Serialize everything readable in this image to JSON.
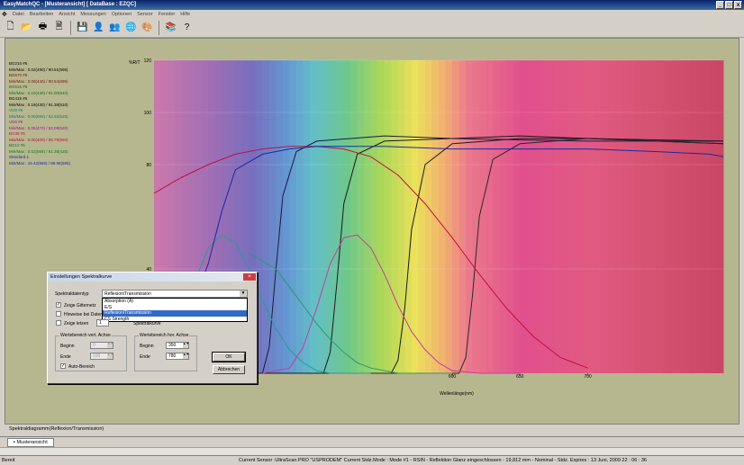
{
  "window": {
    "title": "EasyMatchQC - [Musteransicht]  [ DataBase : EZQC]"
  },
  "menu": [
    "Datei",
    "Bearbeiten",
    "Ansicht",
    "Messungen",
    "Optionen",
    "Sensor",
    "Fenster",
    "Hilfe"
  ],
  "toolbar": {
    "icons": [
      "new-file-icon",
      "open-folder-icon",
      "print-icon",
      "print-preview-icon",
      "save-icon",
      "user-icon",
      "users-icon",
      "standard-icon",
      "sample-icon",
      "database-icon",
      "help-icon"
    ],
    "glyphs": [
      "🗋",
      "📂",
      "🖶",
      "🗎",
      "💾",
      "👤",
      "👥",
      "🌐",
      "🎨",
      "📚",
      "?"
    ]
  },
  "legend": [
    {
      "name": "BG210 #5",
      "value": "Min/Max : 0.02(490) / 90.51(595)",
      "color": "#000000"
    },
    {
      "name": "BG670 #5",
      "value": "Min/Max : 0.08(440) / 90.54(695)",
      "color": "#7a1010"
    },
    {
      "name": "BG515 #5",
      "value": "Min/Max : 0.10(430) / 91.00(640)",
      "color": "#1a6a1a"
    },
    {
      "name": "BG415 #5",
      "value": "Min/Max : 0.18(430) / 91.38(510)",
      "color": "#000000"
    },
    {
      "name": "VG9 #5",
      "value": "Min/Max : 0.00(555) / 52.92(525)",
      "color": "#0a7a6a"
    },
    {
      "name": "VG6 #5",
      "value": "Min/Max : 0.05(470) / 53.09(520)",
      "color": "#a01090"
    },
    {
      "name": "BG38 #5",
      "value": "Min/Max : 0.00(400) / 88.79(550)",
      "color": "#c01040"
    },
    {
      "name": "BG12 #5",
      "value": "Min/Max : 0.02(555) / 81.35(425)",
      "color": "#0a7a20"
    },
    {
      "name": "Standard 1",
      "value": "Min/Max : 15.42(585) / 88.86(585)",
      "color": "#1a2aa0"
    }
  ],
  "chart_data": {
    "type": "line",
    "ylabel": "%R/T",
    "xlabel": "Wellenlänge(nm)",
    "xlim": [
      380,
      800
    ],
    "ylim": [
      0,
      120
    ],
    "yticks": [
      40,
      80,
      100,
      120
    ],
    "xticks": [
      600,
      650,
      700
    ],
    "xtick_labels": [
      "600",
      "650",
      "700"
    ],
    "ytick_labels": [
      "40",
      "80",
      "100",
      "120"
    ],
    "grid": true,
    "series": [
      {
        "name": "BG210 #5",
        "color": "#1a1a1a",
        "x": [
          380,
          555,
          560,
          565,
          570,
          580,
          600,
          650,
          700,
          750,
          800
        ],
        "y": [
          0,
          0,
          5,
          25,
          55,
          80,
          88,
          90,
          90,
          89,
          88
        ]
      },
      {
        "name": "BG670 #5",
        "color": "#2a2a2a",
        "x": [
          380,
          605,
          610,
          615,
          620,
          630,
          650,
          700,
          750,
          800
        ],
        "y": [
          0,
          0,
          6,
          30,
          60,
          82,
          88,
          90,
          89,
          88
        ]
      },
      {
        "name": "BG515 #5",
        "color": "#1a1a1a",
        "x": [
          380,
          505,
          510,
          515,
          520,
          530,
          550,
          600,
          650,
          700,
          800
        ],
        "y": [
          0,
          0,
          8,
          35,
          65,
          84,
          89,
          90,
          91,
          90,
          89
        ]
      },
      {
        "name": "BG415 #5",
        "color": "#1a1a40",
        "x": [
          380,
          460,
          465,
          470,
          475,
          485,
          500,
          550,
          600,
          700,
          800
        ],
        "y": [
          0,
          0,
          10,
          40,
          68,
          85,
          89,
          91,
          90,
          89,
          89
        ]
      },
      {
        "name": "VG9 #5",
        "color": "#2a9a9a",
        "x": [
          380,
          400,
          410,
          420,
          430,
          440,
          450,
          460,
          470,
          480,
          490,
          500,
          510,
          520,
          530,
          540
        ],
        "y": [
          6,
          20,
          35,
          48,
          53,
          50,
          40,
          28,
          17,
          9,
          4,
          1,
          0,
          0,
          0,
          0
        ]
      },
      {
        "name": "VG6 #5",
        "color": "#c040a0",
        "x": [
          460,
          480,
          490,
          500,
          510,
          520,
          530,
          540,
          550,
          560,
          570,
          580,
          590,
          600,
          620,
          650
        ],
        "y": [
          0,
          2,
          10,
          25,
          42,
          52,
          53,
          48,
          38,
          26,
          16,
          9,
          4,
          1,
          0,
          0
        ]
      },
      {
        "name": "BG38 #5",
        "color": "#c01040",
        "x": [
          380,
          400,
          420,
          440,
          460,
          480,
          500,
          520,
          540,
          560,
          580,
          600,
          620,
          640,
          660,
          680,
          700
        ],
        "y": [
          69,
          75,
          80,
          84,
          86,
          87,
          87,
          86,
          83,
          76,
          65,
          52,
          38,
          25,
          14,
          6,
          2
        ]
      },
      {
        "name": "BG12 #5",
        "color": "#2a9a6a",
        "x": [
          450,
          470,
          480,
          490,
          500,
          510,
          520,
          530,
          540,
          550,
          560,
          570,
          580,
          600
        ],
        "y": [
          46,
          40,
          33,
          26,
          19,
          13,
          8,
          4,
          2,
          1,
          0,
          0,
          0,
          0
        ]
      },
      {
        "name": "Standard 1",
        "color": "#1a2aa0",
        "x": [
          380,
          400,
          410,
          420,
          430,
          440,
          460,
          480,
          500,
          550,
          600,
          650,
          700,
          750,
          790,
          800
        ],
        "y": [
          16,
          20,
          28,
          42,
          62,
          78,
          84,
          86,
          87,
          87,
          86,
          86,
          86,
          85,
          84,
          83
        ]
      }
    ]
  },
  "caption": "Spektraldiagramm(Reflexion/Transmission)",
  "tab": "Musteransicht",
  "status": {
    "left": "Bereit",
    "right": "Current Sensor :UltraScan PRO \"USPRODEM\"  Current Stdz.Mode : Mode #1 - RSIN - Reflektion Glanz eingeschlossen - 19,812 mm - Nominal - Stdz. Expires : 13 Juni, 2009 22 : 06 : 36"
  },
  "dialog": {
    "title": "Einstellungen Spektralkurve",
    "type_label": "Spektraldatentyp",
    "type_value": "Reflexion/Transmission",
    "options": [
      "Absorption (A)",
      "E/S",
      "Reflexion/Transmission",
      "CS Strength"
    ],
    "selected_index": 2,
    "chk_grid": "Zeige Gitternetz",
    "chk_hint": "Hinweise bei Daten",
    "chk_last": "Zeige letzen",
    "last_value": "1",
    "last_suffix": "Spektralkurve",
    "vert_group": "Wertebereich vert. Achse",
    "hor_group": "Wertebereich hor. Achse",
    "begin_label": "Beginn",
    "end_label": "Ende",
    "vert_begin": "0",
    "vert_end": "100",
    "hor_begin": "350",
    "hor_end": "780",
    "auto_range": "Auto-Bereich",
    "ok": "OK",
    "cancel": "Abbrechen"
  }
}
